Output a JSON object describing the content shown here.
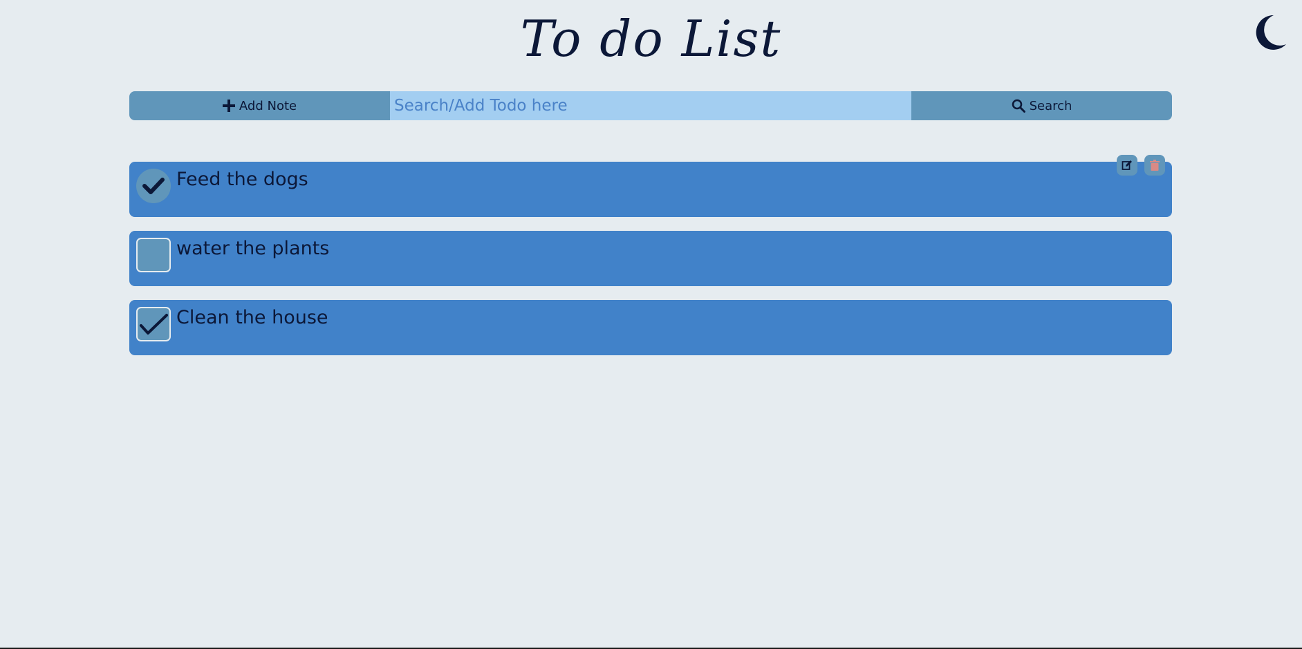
{
  "header": {
    "title": "To do List"
  },
  "theme_toggle": {
    "icon": "moon-icon"
  },
  "toolbar": {
    "add_label": "Add Note",
    "search_placeholder": "Search/Add Todo here",
    "search_value": "",
    "search_label": "Search"
  },
  "todos": [
    {
      "text": "Feed the dogs",
      "checked": true
    },
    {
      "text": "water the plants",
      "checked": false
    },
    {
      "text": "Clean the house",
      "checked": true
    }
  ],
  "colors": {
    "background": "#e6ecf0",
    "toolbar_button": "#6096ba",
    "search_input": "#a3cef1",
    "todo_card": "#4182c9",
    "text_dark": "#0c1838",
    "delete_icon": "#d98a86"
  }
}
